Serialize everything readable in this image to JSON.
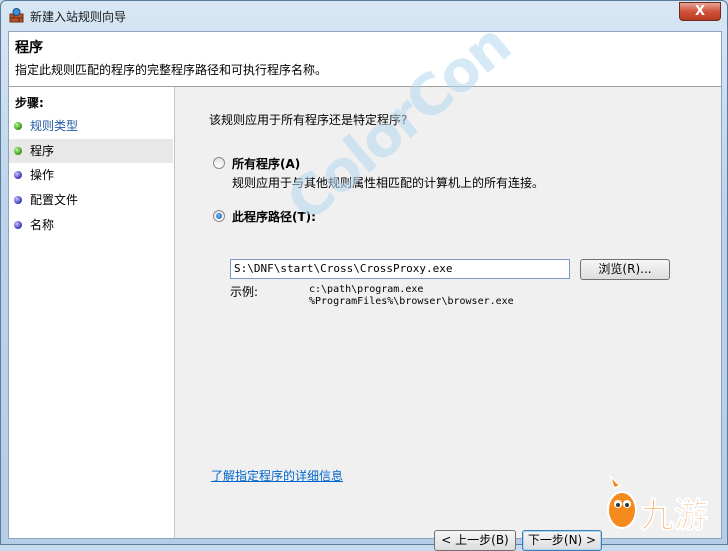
{
  "window": {
    "title": "新建入站规则向导",
    "close_label": "X"
  },
  "header": {
    "title": "程序",
    "subtitle": "指定此规则匹配的程序的完整程序路径和可执行程序名称。"
  },
  "steps": {
    "heading": "步骤:",
    "items": [
      {
        "label": "规则类型",
        "state": "done"
      },
      {
        "label": "程序",
        "state": "current"
      },
      {
        "label": "操作",
        "state": "pending"
      },
      {
        "label": "配置文件",
        "state": "pending"
      },
      {
        "label": "名称",
        "state": "pending"
      }
    ]
  },
  "main": {
    "question": "该规则应用于所有程序还是特定程序?",
    "all_programs": {
      "label": "所有程序(A)",
      "description": "规则应用于与其他规则属性相匹配的计算机上的所有连接。",
      "selected": false
    },
    "this_program": {
      "label": "此程序路径(T):",
      "selected": true,
      "path_value": "S:\\DNF\\start\\Cross\\CrossProxy.exe",
      "browse_label": "浏览(R)..."
    },
    "example_label": "示例:",
    "example_1": "c:\\path\\program.exe",
    "example_2": "%ProgramFiles%\\browser\\browser.exe",
    "learn_more_link": "了解指定程序的详细信息"
  },
  "footer": {
    "back_label": "< 上一步(B)",
    "next_label": "下一步(N) >"
  },
  "watermarks": {
    "colorcon": "ColorCon",
    "jiuyou": "九游"
  }
}
